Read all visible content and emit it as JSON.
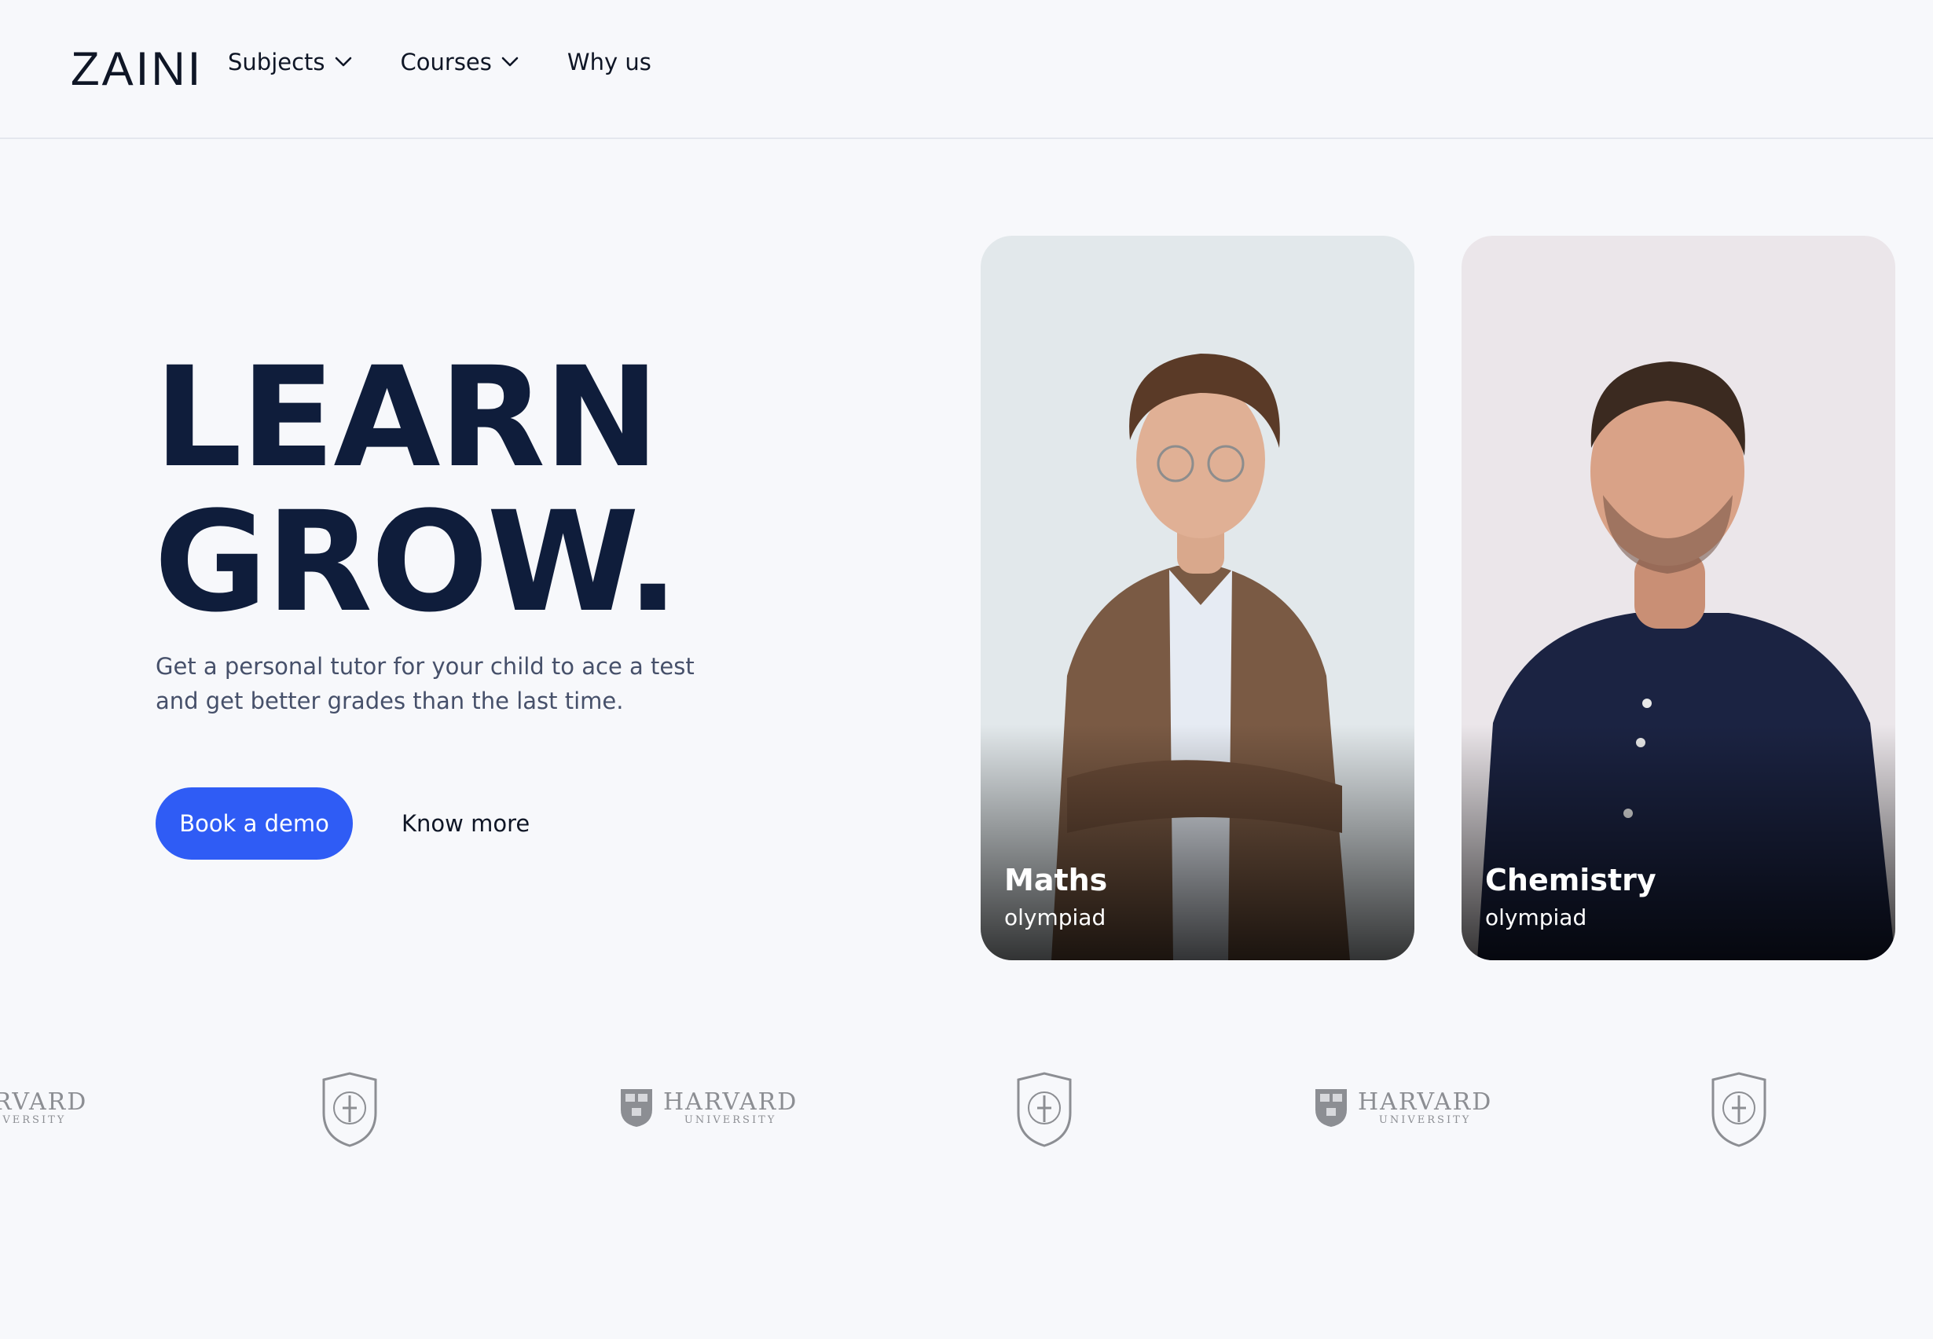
{
  "brand": {
    "logo_text": "ZAINI"
  },
  "nav": {
    "items": [
      {
        "label": "Subjects",
        "has_dropdown": true
      },
      {
        "label": "Courses",
        "has_dropdown": true
      },
      {
        "label": "Why us",
        "has_dropdown": false
      }
    ]
  },
  "hero": {
    "title_line1": "LEARN",
    "title_line2": "GROW.",
    "subtitle": "Get a personal tutor for your child to ace a test and get better grades than the last time.",
    "primary_cta": "Book a demo",
    "secondary_cta": "Know more"
  },
  "cards": [
    {
      "title": "Maths",
      "subtitle": "olympiad"
    },
    {
      "title": "Chemistry",
      "subtitle": "olympiad"
    }
  ],
  "partner_logos": [
    {
      "name": "HARVARD",
      "sub": "UNIVERSITY"
    },
    {
      "name": "crest",
      "sub": ""
    },
    {
      "name": "HARVARD",
      "sub": "UNIVERSITY"
    },
    {
      "name": "crest",
      "sub": ""
    },
    {
      "name": "HARVARD",
      "sub": "UNIVERSITY"
    },
    {
      "name": "crest",
      "sub": ""
    }
  ],
  "colors": {
    "background": "#f7f8fb",
    "primary": "#2f5cf5",
    "heading": "#0f1d3b",
    "body_text": "#46506a",
    "logo_gray": "#8c8e93"
  }
}
